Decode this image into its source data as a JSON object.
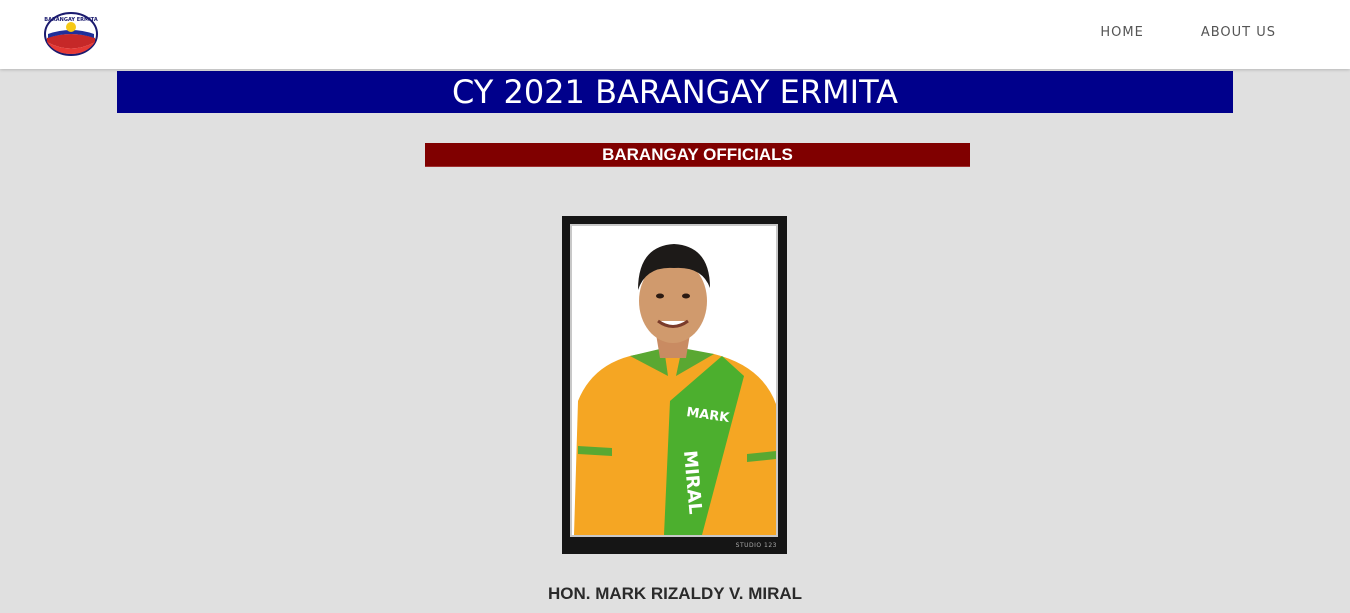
{
  "header": {
    "logo_text": "BARANGAY ERMITA",
    "nav": [
      {
        "label": "HOME"
      },
      {
        "label": "ABOUT US"
      }
    ]
  },
  "title_banner": "CY 2021 BARANGAY ERMITA",
  "section_banner": "BARANGAY OFFICIALS",
  "official": {
    "sash_text": [
      "MARK",
      "MIRAL"
    ],
    "studio_mark": "STUDIO 123",
    "name": "HON. MARK RIZALDY V. MIRAL"
  },
  "colors": {
    "title_bg": "#00008b",
    "section_bg": "#800000",
    "page_bg": "#e0e0e0",
    "shirt": "#f5a623",
    "sash": "#4caf2e"
  }
}
